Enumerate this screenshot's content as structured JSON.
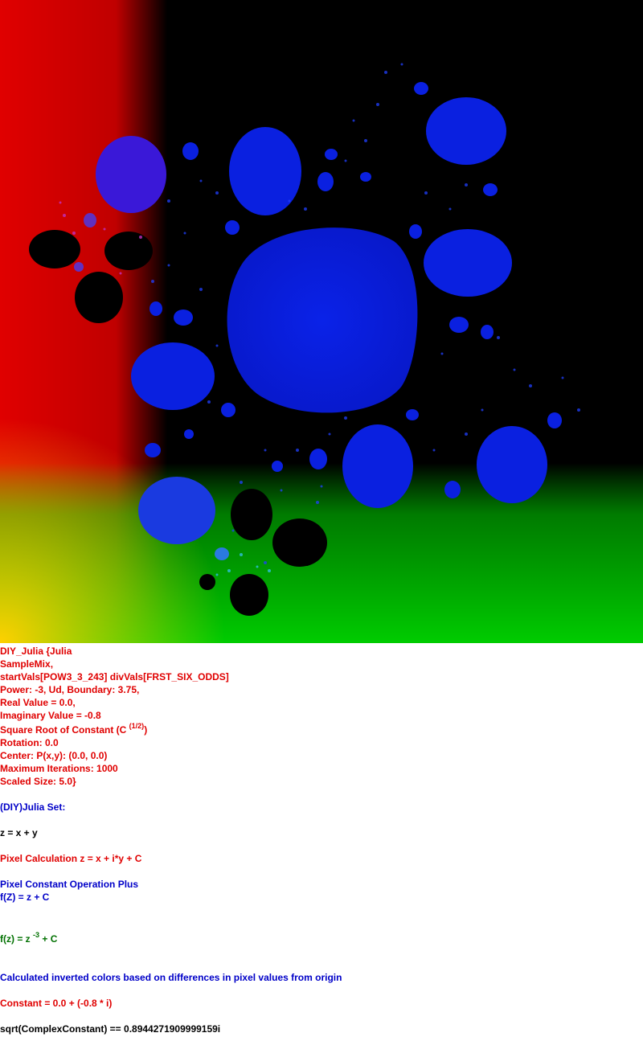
{
  "image": {
    "description_icon": "julia-fractal-render",
    "colors": {
      "background_top_left": "#ff0000",
      "background_bottom": "#00cc00",
      "background_top_right": "#000000",
      "fractal_fill": "#0a1fe0",
      "fractal_dark": "#000000",
      "bottom_left_corner": "#ffcc00"
    }
  },
  "info": {
    "line1": "DIY_Julia {Julia",
    "line2": "SampleMix,",
    "line3": "startVals[POW3_3_243] divVals[FRST_SIX_ODDS]",
    "line4": "Power: -3, Ud, Boundary: 3.75,",
    "line5": "Real Value = 0.0,",
    "line6": "Imaginary Value = -0.8",
    "sqrt_label": "Square Root of Constant (C ",
    "sqrt_sup": "(1/2)",
    "sqrt_close": ")",
    "rotation": "Rotation: 0.0",
    "center": "Center: P(x,y): (0.0, 0.0)",
    "max_iter": "Maximum Iterations: 1000",
    "scaled": "Scaled Size: 5.0}",
    "diy_title": "(DIY)Julia Set:",
    "z_formula": "z = x + y",
    "pixel_calc": "Pixel Calculation z = x + i*y + C",
    "pixel_const_op": "Pixel Constant Operation Plus",
    "fz_plus": "f(Z) = z + C",
    "fz_pow_pre": "f(z) = z ",
    "fz_pow_sup": "-3",
    "fz_pow_post": " + C",
    "inverted": "Calculated inverted colors based on differences in pixel values from origin",
    "constant": "Constant = 0.0 + (-0.8 * i)",
    "sqrt_value": "sqrt(ComplexConstant) == 0.8944271909999159i"
  }
}
